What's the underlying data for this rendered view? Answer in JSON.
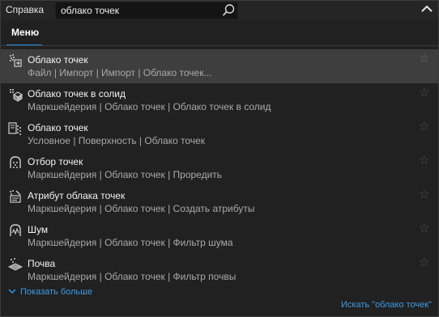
{
  "topbar": {
    "help_label": "Справка",
    "search_value": "облако точек"
  },
  "tabs": [
    {
      "label": "Меню",
      "active": true
    }
  ],
  "results": [
    {
      "title": "Облако точек",
      "path": "Файл | Импорт | Импорт | Облако точек...",
      "icon": "point-cloud-import-icon",
      "selected": true
    },
    {
      "title": "Облако точек в солид",
      "path": "Маркшейдерия | Облако точек | Облако точек в солид",
      "icon": "point-cloud-to-solid-icon",
      "selected": false
    },
    {
      "title": "Облако точек",
      "path": "Условное | Поверхность | Облако точек",
      "icon": "surface-point-cloud-icon",
      "selected": false
    },
    {
      "title": "Отбор точек",
      "path": "Маркшейдерия | Облако точек | Проредить",
      "icon": "point-thinning-icon",
      "selected": false
    },
    {
      "title": "Атрибут облака точек",
      "path": "Маркшейдерия | Облако точек | Создать атрибуты",
      "icon": "point-cloud-attribute-icon",
      "selected": false
    },
    {
      "title": "Шум",
      "path": "Маркшейдерия | Облако точек | Фильтр шума",
      "icon": "noise-filter-icon",
      "selected": false
    },
    {
      "title": "Почва",
      "path": "Маркшейдерия | Облако точек | Фильтр почвы",
      "icon": "ground-filter-icon",
      "selected": false
    }
  ],
  "footer": {
    "show_more": "Показать больше",
    "search_all": "Искать \"облако точек\""
  },
  "colors": {
    "accent": "#2b8de0",
    "link": "#3b9be6",
    "selected_row": "#3e3e3e"
  }
}
